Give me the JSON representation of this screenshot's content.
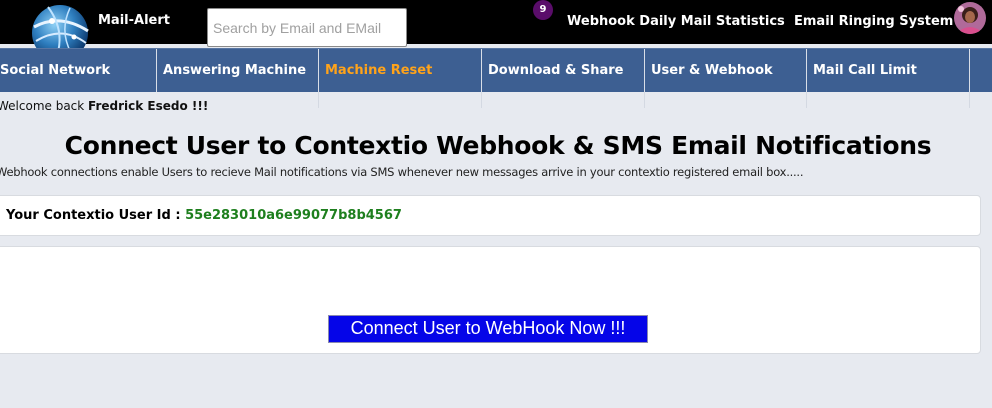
{
  "header": {
    "brand": "Mail-Alert",
    "search_placeholder": "Search by Email and EMail",
    "notification_count": "9",
    "links": [
      {
        "label": "Webhook Daily Mail Statistics"
      },
      {
        "label": "Email Ringing System"
      }
    ]
  },
  "nav": {
    "items": [
      {
        "label": "Social Network"
      },
      {
        "label": "Answering Machine"
      },
      {
        "label": "Machine Reset"
      },
      {
        "label": "Download & Share"
      },
      {
        "label": "User & Webhook"
      },
      {
        "label": "Mail Call Limit"
      }
    ],
    "active": "Machine Reset"
  },
  "welcome": {
    "prefix": "Welcome back ",
    "user": "Fredrick Esedo !!!"
  },
  "main": {
    "title": "Connect User to Contextio Webhook & SMS Email Notifications",
    "description": "Webhook connections enable Users to recieve Mail notifications via SMS whenever new messages arrive in your contextio registered email box.....",
    "user_id_label": "Your Contextio User Id : ",
    "user_id_value": "55e283010a6e99077b8b4567",
    "connect_button": "Connect User to WebHook Now !!!"
  },
  "colors": {
    "topbar": "#000000",
    "navbar": "#3d5f92",
    "active_nav": "#ffa31a",
    "user_id": "#1e7f1e",
    "button": "#0505e8"
  }
}
